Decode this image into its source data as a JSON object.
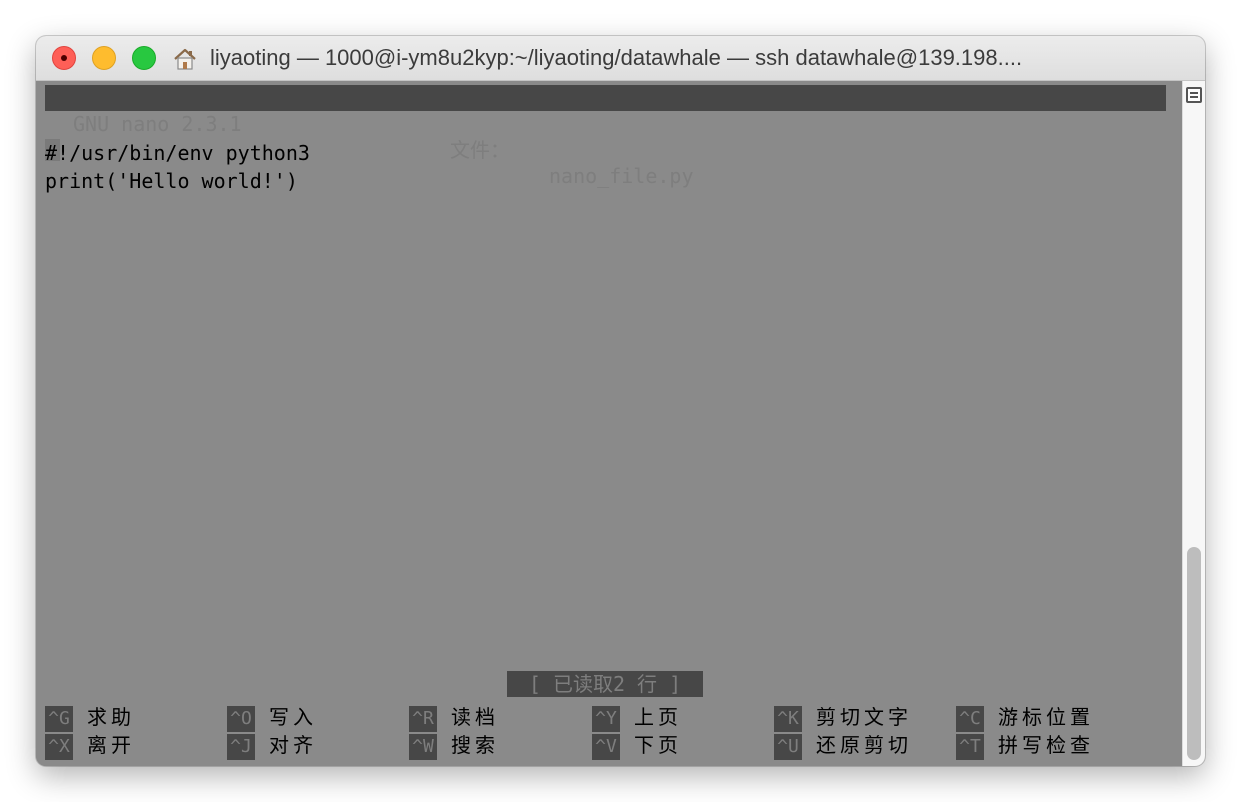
{
  "window": {
    "title": "liyaoting — 1000@i-ym8u2kyp:~/liyaoting/datawhale — ssh datawhale@139.198...."
  },
  "nano": {
    "version": "GNU nano 2.3.1",
    "file_label": "文件：",
    "file_name": "nano_file.py",
    "lines": [
      "#!/usr/bin/env python3",
      "print('Hello world!')"
    ],
    "status": "[ 已读取2 行 ]"
  },
  "shortcuts": [
    {
      "key": "^G",
      "label": "求助"
    },
    {
      "key": "^O",
      "label": "写入"
    },
    {
      "key": "^R",
      "label": "读档"
    },
    {
      "key": "^Y",
      "label": "上页"
    },
    {
      "key": "^K",
      "label": "剪切文字"
    },
    {
      "key": "^C",
      "label": "游标位置"
    },
    {
      "key": "^X",
      "label": "离开"
    },
    {
      "key": "^J",
      "label": "对齐"
    },
    {
      "key": "^W",
      "label": "搜索"
    },
    {
      "key": "^V",
      "label": "下页"
    },
    {
      "key": "^U",
      "label": "还原剪切"
    },
    {
      "key": "^T",
      "label": "拼写检查"
    }
  ],
  "icons": {
    "home": "home-icon",
    "scroll_menu": "list-icon"
  },
  "colors": {
    "close": "#fe5f57",
    "minimize": "#febc2e",
    "maximize": "#28c840",
    "terminal_bg": "#8a8a8a",
    "nano_bar": "#474747"
  }
}
